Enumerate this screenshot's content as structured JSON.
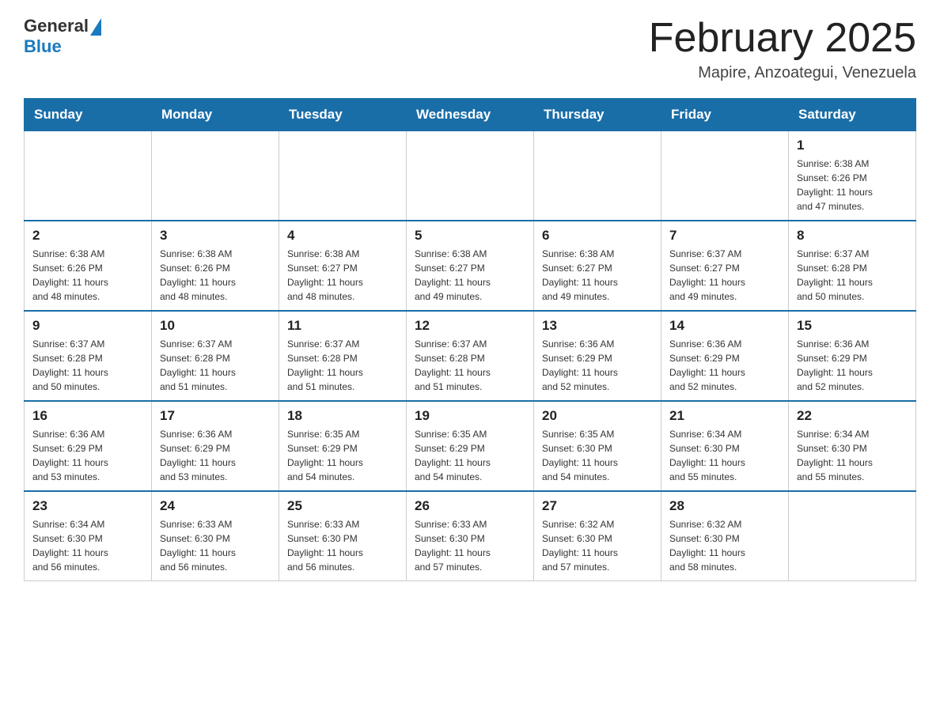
{
  "logo": {
    "general": "General",
    "blue": "Blue"
  },
  "header": {
    "title": "February 2025",
    "subtitle": "Mapire, Anzoategui, Venezuela"
  },
  "weekdays": [
    "Sunday",
    "Monday",
    "Tuesday",
    "Wednesday",
    "Thursday",
    "Friday",
    "Saturday"
  ],
  "weeks": [
    [
      {
        "day": "",
        "info": ""
      },
      {
        "day": "",
        "info": ""
      },
      {
        "day": "",
        "info": ""
      },
      {
        "day": "",
        "info": ""
      },
      {
        "day": "",
        "info": ""
      },
      {
        "day": "",
        "info": ""
      },
      {
        "day": "1",
        "info": "Sunrise: 6:38 AM\nSunset: 6:26 PM\nDaylight: 11 hours\nand 47 minutes."
      }
    ],
    [
      {
        "day": "2",
        "info": "Sunrise: 6:38 AM\nSunset: 6:26 PM\nDaylight: 11 hours\nand 48 minutes."
      },
      {
        "day": "3",
        "info": "Sunrise: 6:38 AM\nSunset: 6:26 PM\nDaylight: 11 hours\nand 48 minutes."
      },
      {
        "day": "4",
        "info": "Sunrise: 6:38 AM\nSunset: 6:27 PM\nDaylight: 11 hours\nand 48 minutes."
      },
      {
        "day": "5",
        "info": "Sunrise: 6:38 AM\nSunset: 6:27 PM\nDaylight: 11 hours\nand 49 minutes."
      },
      {
        "day": "6",
        "info": "Sunrise: 6:38 AM\nSunset: 6:27 PM\nDaylight: 11 hours\nand 49 minutes."
      },
      {
        "day": "7",
        "info": "Sunrise: 6:37 AM\nSunset: 6:27 PM\nDaylight: 11 hours\nand 49 minutes."
      },
      {
        "day": "8",
        "info": "Sunrise: 6:37 AM\nSunset: 6:28 PM\nDaylight: 11 hours\nand 50 minutes."
      }
    ],
    [
      {
        "day": "9",
        "info": "Sunrise: 6:37 AM\nSunset: 6:28 PM\nDaylight: 11 hours\nand 50 minutes."
      },
      {
        "day": "10",
        "info": "Sunrise: 6:37 AM\nSunset: 6:28 PM\nDaylight: 11 hours\nand 51 minutes."
      },
      {
        "day": "11",
        "info": "Sunrise: 6:37 AM\nSunset: 6:28 PM\nDaylight: 11 hours\nand 51 minutes."
      },
      {
        "day": "12",
        "info": "Sunrise: 6:37 AM\nSunset: 6:28 PM\nDaylight: 11 hours\nand 51 minutes."
      },
      {
        "day": "13",
        "info": "Sunrise: 6:36 AM\nSunset: 6:29 PM\nDaylight: 11 hours\nand 52 minutes."
      },
      {
        "day": "14",
        "info": "Sunrise: 6:36 AM\nSunset: 6:29 PM\nDaylight: 11 hours\nand 52 minutes."
      },
      {
        "day": "15",
        "info": "Sunrise: 6:36 AM\nSunset: 6:29 PM\nDaylight: 11 hours\nand 52 minutes."
      }
    ],
    [
      {
        "day": "16",
        "info": "Sunrise: 6:36 AM\nSunset: 6:29 PM\nDaylight: 11 hours\nand 53 minutes."
      },
      {
        "day": "17",
        "info": "Sunrise: 6:36 AM\nSunset: 6:29 PM\nDaylight: 11 hours\nand 53 minutes."
      },
      {
        "day": "18",
        "info": "Sunrise: 6:35 AM\nSunset: 6:29 PM\nDaylight: 11 hours\nand 54 minutes."
      },
      {
        "day": "19",
        "info": "Sunrise: 6:35 AM\nSunset: 6:29 PM\nDaylight: 11 hours\nand 54 minutes."
      },
      {
        "day": "20",
        "info": "Sunrise: 6:35 AM\nSunset: 6:30 PM\nDaylight: 11 hours\nand 54 minutes."
      },
      {
        "day": "21",
        "info": "Sunrise: 6:34 AM\nSunset: 6:30 PM\nDaylight: 11 hours\nand 55 minutes."
      },
      {
        "day": "22",
        "info": "Sunrise: 6:34 AM\nSunset: 6:30 PM\nDaylight: 11 hours\nand 55 minutes."
      }
    ],
    [
      {
        "day": "23",
        "info": "Sunrise: 6:34 AM\nSunset: 6:30 PM\nDaylight: 11 hours\nand 56 minutes."
      },
      {
        "day": "24",
        "info": "Sunrise: 6:33 AM\nSunset: 6:30 PM\nDaylight: 11 hours\nand 56 minutes."
      },
      {
        "day": "25",
        "info": "Sunrise: 6:33 AM\nSunset: 6:30 PM\nDaylight: 11 hours\nand 56 minutes."
      },
      {
        "day": "26",
        "info": "Sunrise: 6:33 AM\nSunset: 6:30 PM\nDaylight: 11 hours\nand 57 minutes."
      },
      {
        "day": "27",
        "info": "Sunrise: 6:32 AM\nSunset: 6:30 PM\nDaylight: 11 hours\nand 57 minutes."
      },
      {
        "day": "28",
        "info": "Sunrise: 6:32 AM\nSunset: 6:30 PM\nDaylight: 11 hours\nand 58 minutes."
      },
      {
        "day": "",
        "info": ""
      }
    ]
  ]
}
